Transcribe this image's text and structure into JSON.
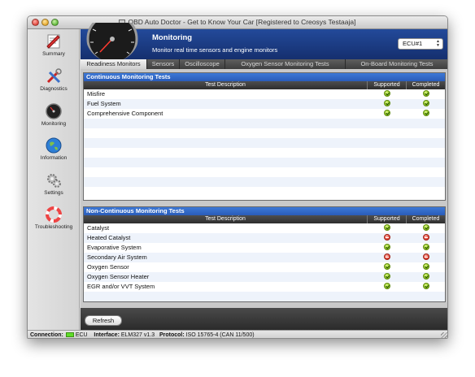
{
  "window": {
    "title": "OBD Auto Doctor - Get to Know Your Car [Registered to Creosys Testaaja]"
  },
  "sidebar": {
    "items": [
      {
        "label": "Summary",
        "icon": "summary-icon"
      },
      {
        "label": "Diagnostics",
        "icon": "diagnostics-icon"
      },
      {
        "label": "Monitoring",
        "icon": "monitoring-gauge-icon"
      },
      {
        "label": "Information",
        "icon": "information-globe-icon"
      },
      {
        "label": "Settings",
        "icon": "settings-gears-icon"
      },
      {
        "label": "Troubleshooting",
        "icon": "lifebuoy-icon"
      }
    ]
  },
  "header": {
    "title": "Monitoring",
    "subtitle": "Monitor real time sensors and engine monitors",
    "ecu_value": "ECU#1"
  },
  "tabs": [
    {
      "label": "Readiness Monitors",
      "active": true
    },
    {
      "label": "Sensors",
      "active": false
    },
    {
      "label": "Oscilloscope",
      "active": false
    },
    {
      "label": "Oxygen Sensor Monitoring Tests",
      "active": false
    },
    {
      "label": "On-Board Monitoring Tests",
      "active": false
    }
  ],
  "continuous": {
    "title": "Continuous Monitoring Tests",
    "headers": {
      "desc": "Test Description",
      "supported": "Supported",
      "completed": "Completed"
    },
    "rows": [
      {
        "desc": "Misfire",
        "supported": "ok",
        "completed": "ok"
      },
      {
        "desc": "Fuel System",
        "supported": "ok",
        "completed": "ok"
      },
      {
        "desc": "Comprehensive Component",
        "supported": "ok",
        "completed": "ok"
      }
    ]
  },
  "non_continuous": {
    "title": "Non-Continuous Monitoring Tests",
    "headers": {
      "desc": "Test Description",
      "supported": "Supported",
      "completed": "Completed"
    },
    "rows": [
      {
        "desc": "Catalyst",
        "supported": "ok",
        "completed": "ok"
      },
      {
        "desc": "Heated Catalyst",
        "supported": "no",
        "completed": "no"
      },
      {
        "desc": "Evaporative System",
        "supported": "ok",
        "completed": "ok"
      },
      {
        "desc": "Secondary Air System",
        "supported": "no",
        "completed": "no"
      },
      {
        "desc": "Oxygen Sensor",
        "supported": "ok",
        "completed": "ok"
      },
      {
        "desc": "Oxygen Sensor Heater",
        "supported": "ok",
        "completed": "ok"
      },
      {
        "desc": "EGR and/or VVT System",
        "supported": "ok",
        "completed": "ok"
      }
    ]
  },
  "toolbar": {
    "refresh_label": "Refresh"
  },
  "statusbar": {
    "connection_label": "Connection:",
    "connection_value": "ECU",
    "interface_label": "Interface:",
    "interface_value": "ELM327 v1.3",
    "protocol_label": "Protocol:",
    "protocol_value": "ISO 15765-4 (CAN 11/500)"
  },
  "colors": {
    "accent": "#2a5cb8",
    "ok": "#8ac21a",
    "fail": "#e04030"
  }
}
